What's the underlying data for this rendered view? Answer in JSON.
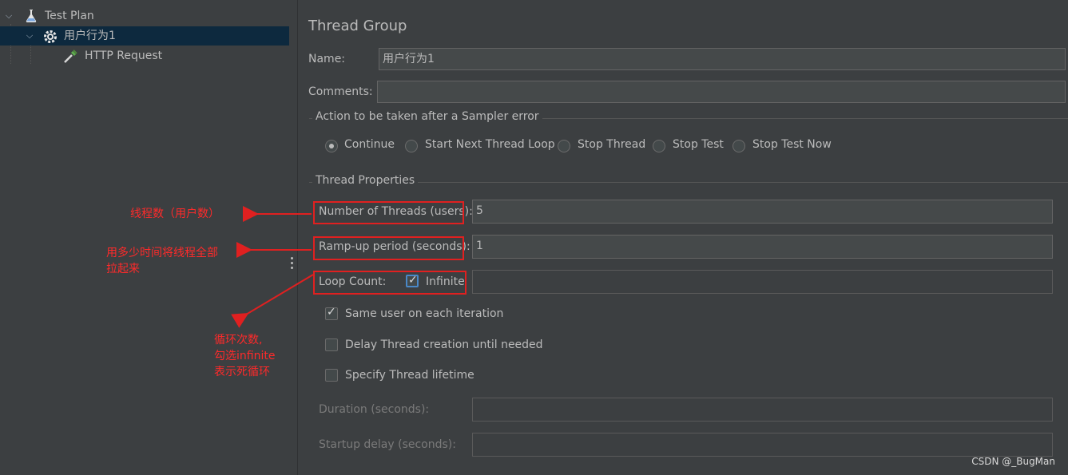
{
  "tree": {
    "items": [
      {
        "label": "Test Plan",
        "icon": "flask-icon"
      },
      {
        "label": "用户行为1",
        "icon": "gear-icon"
      },
      {
        "label": "HTTP Request",
        "icon": "pipette-icon"
      }
    ]
  },
  "panel": {
    "title": "Thread Group",
    "name_label": "Name:",
    "name_value": "用户行为1",
    "comments_label": "Comments:",
    "comments_value": "",
    "action_section": "Action to be taken after a Sampler error",
    "actions": [
      {
        "label": "Continue",
        "selected": true
      },
      {
        "label": "Start Next Thread Loop",
        "selected": false
      },
      {
        "label": "Stop Thread",
        "selected": false
      },
      {
        "label": "Stop Test",
        "selected": false
      },
      {
        "label": "Stop Test Now",
        "selected": false
      }
    ],
    "props_section": "Thread Properties",
    "threads_label": "Number of Threads (users):",
    "threads_value": "5",
    "rampup_label": "Ramp-up period (seconds):",
    "rampup_value": "1",
    "loop_label": "Loop Count:",
    "infinite_label": "Infinite",
    "infinite_checked": true,
    "loop_value": "",
    "same_user_label": "Same user on each iteration",
    "same_user_checked": true,
    "delay_label": "Delay Thread creation until needed",
    "delay_checked": false,
    "lifetime_label": "Specify Thread lifetime",
    "lifetime_checked": false,
    "duration_label": "Duration (seconds):",
    "duration_value": "",
    "startup_label": "Startup delay (seconds):",
    "startup_value": ""
  },
  "annotations": {
    "threads": "线程数（用户数）",
    "rampup_line1": "用多少时间将线程全部",
    "rampup_line2": "拉起来",
    "loop_line1": "循环次数,",
    "loop_line2": "勾选infinite",
    "loop_line3": "表示死循环",
    "color": "#ff2a2a"
  },
  "watermark": "CSDN @_BugMan"
}
